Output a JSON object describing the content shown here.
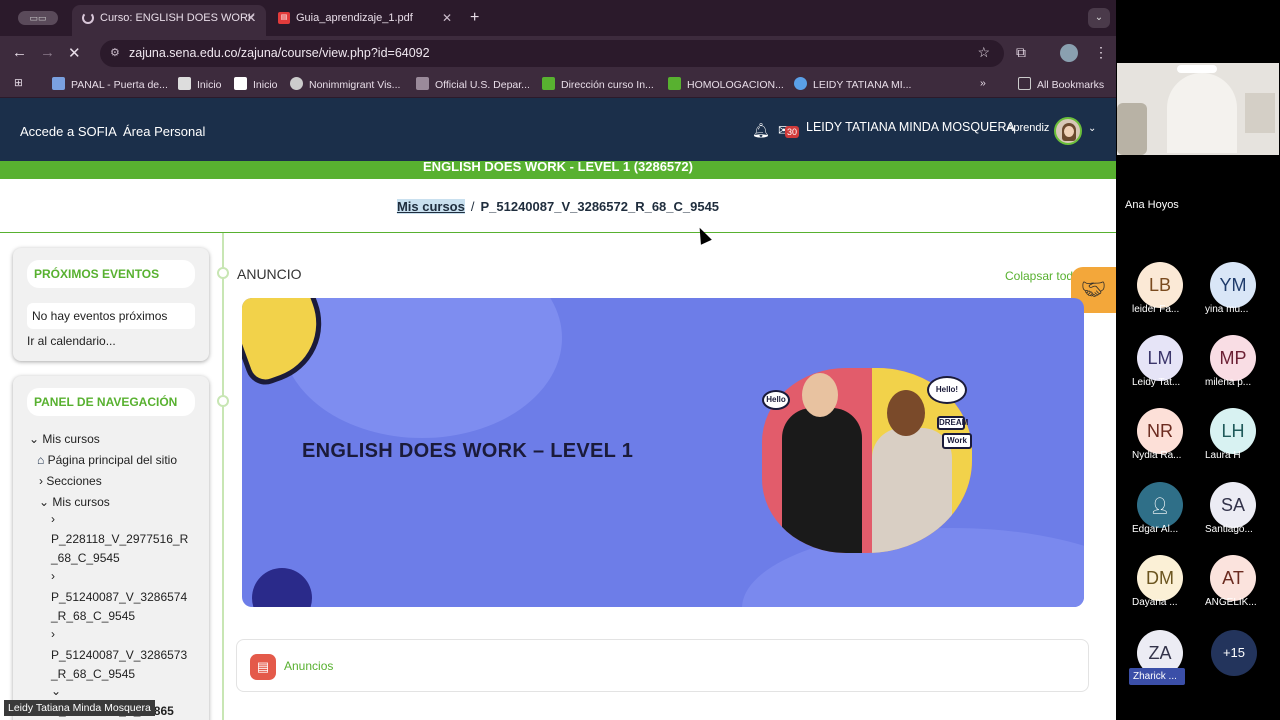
{
  "browser": {
    "tabs": [
      {
        "title": "Curso: ENGLISH DOES WORK"
      },
      {
        "title": "Guia_aprendizaje_1.pdf"
      }
    ],
    "url": "zajuna.sena.edu.co/zajuna/course/view.php?id=64092",
    "bookmarks": [
      "PANAL - Puerta de...",
      "Inicio",
      "Inicio",
      "Nonimmigrant Vis...",
      "Official U.S. Depar...",
      "Dirección curso In...",
      "HOMOLOGACION...",
      "LEIDY TATIANA MI..."
    ],
    "all_bookmarks": "All Bookmarks",
    "more": "»"
  },
  "site": {
    "nav": [
      "Accede a SOFIA",
      "Área Personal"
    ],
    "messages_count": "30",
    "user_name": "LEIDY TATIANA MINDA MOSQUERA",
    "user_role": "Aprendiz",
    "course_band": "ENGLISH DOES WORK - LEVEL 1 (3286572)",
    "breadcrumb": {
      "link": "Mis cursos",
      "sep": "/",
      "current": "P_51240087_V_3286572_R_68_C_9545"
    }
  },
  "sidebar": {
    "events": {
      "title": "PRÓXIMOS EVENTOS",
      "empty": "No hay eventos próximos",
      "calendar_link": "Ir al calendario..."
    },
    "nav": {
      "title": "PANEL DE NAVEGACIÓN",
      "root": "Mis cursos",
      "home": "Página principal del sitio",
      "sections": "Secciones",
      "my_courses": "Mis cursos",
      "courses": [
        "P_228118_V_2977516_R_68_C_9545",
        "P_51240087_V_3286574_R_68_C_9545",
        "P_51240087_V_3286573_R_68_C_9545",
        "P_51240087_V_32865"
      ]
    }
  },
  "main": {
    "section_title": "ANUNCIO",
    "collapse_all": "Colapsar todo",
    "banner_title": "ENGLISH DOES WORK – LEVEL 1",
    "stickers": [
      "Hello!",
      "Hello",
      "DREAM",
      "Work"
    ],
    "announcements_label": "Anuncios"
  },
  "meeting": {
    "camera_name": "Ana Hoyos",
    "participants": [
      {
        "initials": "LB",
        "name": "leider Fa...",
        "bg": "#fbe9d6",
        "fg": "#7a4a1e"
      },
      {
        "initials": "YM",
        "name": "yina mu...",
        "bg": "#d9e6f7",
        "fg": "#1f3b6b"
      },
      {
        "initials": "LM",
        "name": "Leidy Tat...",
        "bg": "#e6e4f7",
        "fg": "#3b356b"
      },
      {
        "initials": "MP",
        "name": "milena p...",
        "bg": "#f9dde4",
        "fg": "#6b1f33"
      },
      {
        "initials": "NR",
        "name": "Nydia Ra...",
        "bg": "#fde0d8",
        "fg": "#6b2a1f"
      },
      {
        "initials": "LH",
        "name": "Laura H",
        "bg": "#d8f2f2",
        "fg": "#1f5a5a"
      },
      {
        "initials": "",
        "name": "Edgar Al...",
        "bg": "#2f6f88",
        "fg": "#ffffff"
      },
      {
        "initials": "SA",
        "name": "Santiago...",
        "bg": "#ececf4",
        "fg": "#33334a"
      },
      {
        "initials": "DM",
        "name": "Dayana ...",
        "bg": "#fbf0d6",
        "fg": "#6b551f"
      },
      {
        "initials": "AT",
        "name": "ANGELIK...",
        "bg": "#fbe3dd",
        "fg": "#6b2a1f"
      },
      {
        "initials": "ZA",
        "name": "Zharick ...",
        "bg": "#ececf4",
        "fg": "#33334a"
      }
    ],
    "more": "+15",
    "presenter": "Leidy Tatiana Minda Mosquera"
  }
}
